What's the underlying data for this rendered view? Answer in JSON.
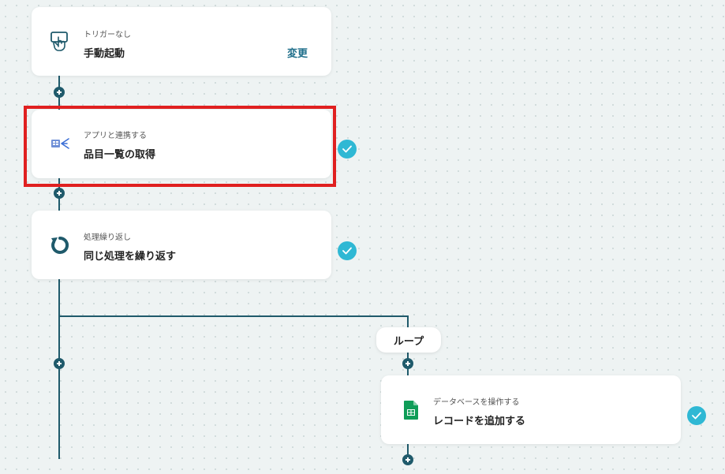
{
  "steps": [
    {
      "subtitle": "トリガーなし",
      "title": "手動起動",
      "action_label": "変更",
      "icon": "hand-pointer-icon"
    },
    {
      "subtitle": "アプリと連携する",
      "title": "品目一覧の取得",
      "icon": "app-integration-icon",
      "status": "complete",
      "highlighted": true
    },
    {
      "subtitle": "処理繰り返し",
      "title": "同じ処理を繰り返す",
      "icon": "loop-arrow-icon",
      "status": "complete"
    },
    {
      "subtitle": "データベースを操作する",
      "title": "レコードを追加する",
      "icon": "google-sheets-icon",
      "status": "complete"
    }
  ],
  "loop_label": "ループ",
  "colors": {
    "line": "#1f5a6b",
    "check": "#2fb8d4",
    "highlight": "#e02020",
    "sheets": "#0f9d58",
    "link": "#1f6f8b"
  }
}
